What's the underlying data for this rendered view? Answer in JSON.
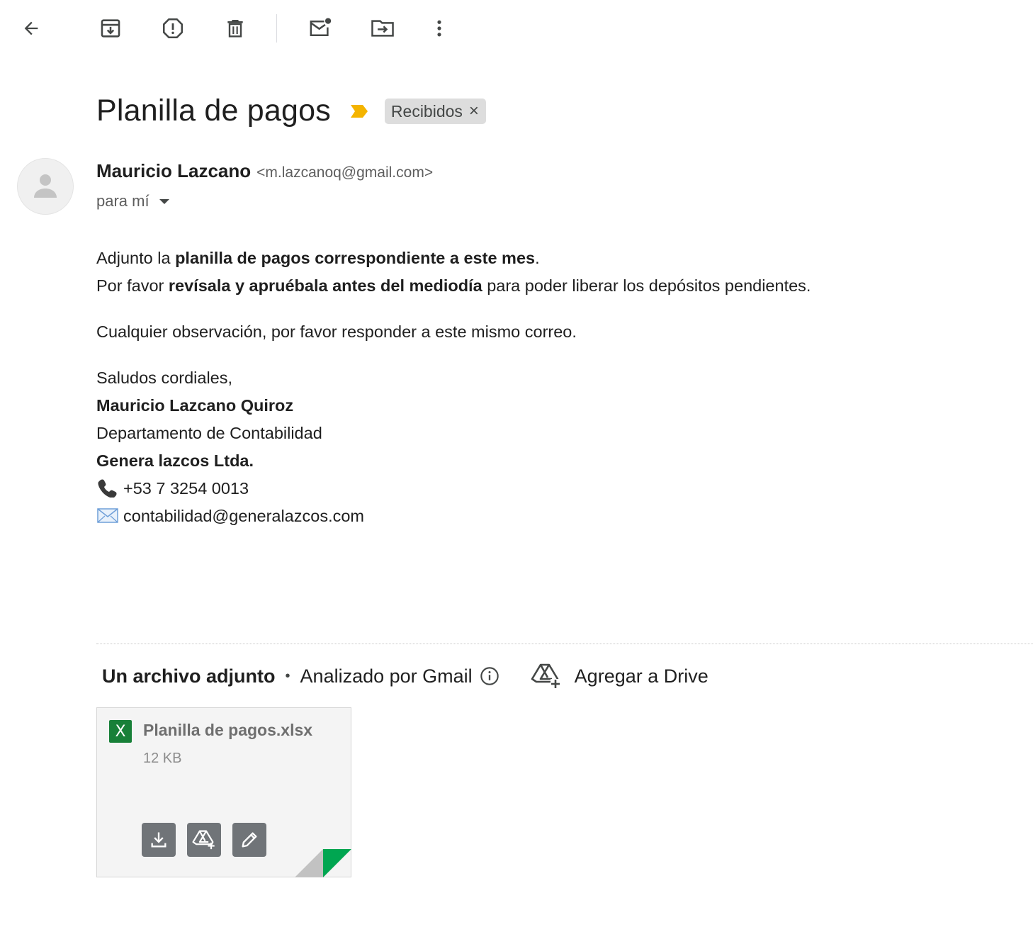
{
  "toolbar": {
    "back_icon": "arrow-left-icon",
    "archive_icon": "archive-icon",
    "spam_icon": "report-spam-icon",
    "delete_icon": "trash-icon",
    "mark_unread_icon": "mark-unread-icon",
    "move_icon": "move-to-folder-icon",
    "more_icon": "more-vertical-icon"
  },
  "email": {
    "subject": "Planilla de pagos",
    "importance_color": "#f4b400",
    "label": "Recibidos",
    "label_close": "×",
    "sender_name": "Mauricio Lazcano",
    "sender_email": "<m.lazcanoq@gmail.com>",
    "to": "para mí",
    "body": {
      "p1_a": "Adjunto la ",
      "p1_b": "planilla de pagos correspondiente a este mes",
      "p1_c": ".",
      "p2_a": "Por favor ",
      "p2_b": "revísala y apruébala antes del mediodía",
      "p2_c": " para poder liberar los depósitos pendientes.",
      "p3": "Cualquier observación, por favor responder a este mismo correo.",
      "greeting": "Saludos cordiales,",
      "sig_name": "Mauricio Lazcano Quiroz",
      "sig_dept": "Departamento de Contabilidad",
      "sig_company": "Genera lazcos Ltda.",
      "sig_phone": "+53 7 3254 0013",
      "sig_email": "contabilidad@generalazcos.com"
    }
  },
  "attachments": {
    "count_label": "Un archivo adjunto",
    "separator": "•",
    "scan_label": "Analizado por Gmail",
    "add_drive_label": "Agregar a Drive",
    "file": {
      "badge": "X",
      "name": "Planilla de pagos.xlsx",
      "size": "12 KB",
      "badge_color": "#188038",
      "fold_color": "#00a651"
    }
  }
}
